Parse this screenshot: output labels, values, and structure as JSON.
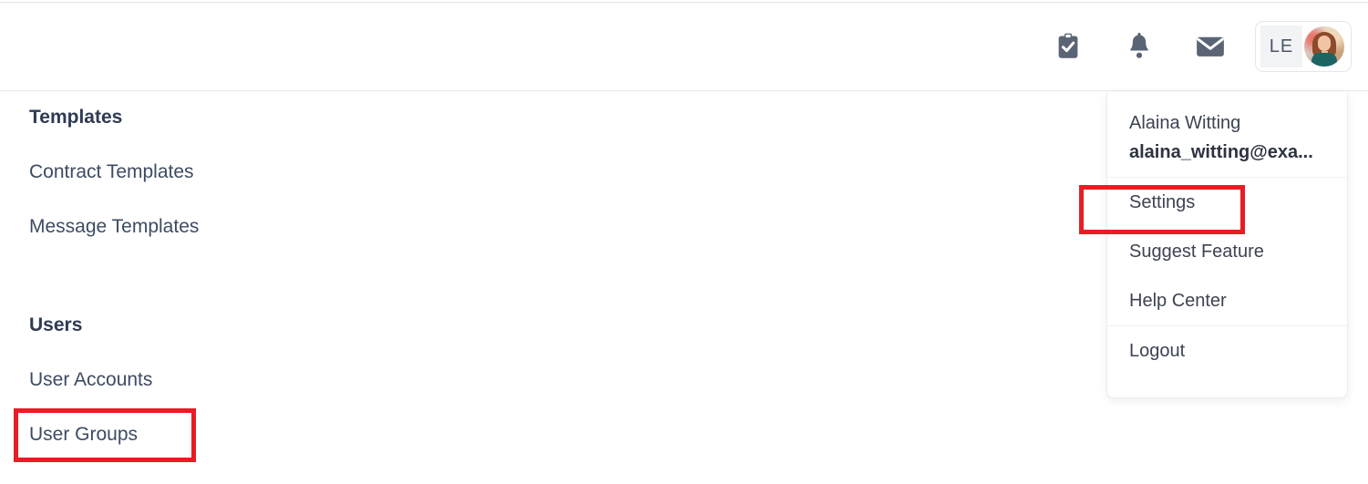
{
  "header": {
    "icons": [
      {
        "name": "tasks-clipboard-icon",
        "label": "Tasks"
      },
      {
        "name": "notifications-bell-icon",
        "label": "Notifications"
      },
      {
        "name": "messages-envelope-icon",
        "label": "Messages"
      }
    ],
    "user_chip": {
      "initials": "LE",
      "avatar_alt": "User profile photo"
    }
  },
  "sidebar": {
    "sections": [
      {
        "heading": "Templates",
        "items": [
          {
            "label": "Contract Templates"
          },
          {
            "label": "Message Templates"
          }
        ]
      },
      {
        "heading": "Users",
        "items": [
          {
            "label": "User Accounts"
          },
          {
            "label": "User Groups"
          }
        ]
      }
    ]
  },
  "dropdown": {
    "profile": {
      "name": "Alaina Witting",
      "email": "alaina_witting@exa..."
    },
    "items": [
      {
        "label": "Settings"
      },
      {
        "label": "Suggest Feature"
      },
      {
        "label": "Help Center"
      },
      {
        "label": "Logout"
      }
    ]
  },
  "annotations": {
    "highlight_color": "#e81c24",
    "boxes": [
      {
        "target": "Settings"
      },
      {
        "target": "User Groups"
      }
    ]
  }
}
